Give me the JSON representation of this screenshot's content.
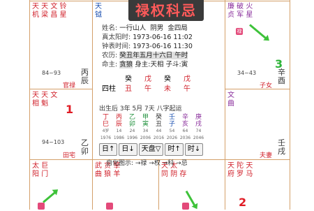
{
  "banner": "禄权科忌",
  "chart_info": {
    "name_label": "姓名:",
    "name_value": "一行山人",
    "gender": "阴男",
    "bureau": "金四局",
    "solar_label": "真太阳时:",
    "solar_value": "1973-06-16",
    "solar_time": "11:02",
    "clock_label": "钟表时间:",
    "clock_value": "1973-06-16",
    "clock_time": "11:30",
    "lunar_label": "农历:",
    "lunar_value": "癸丑年五月十六日 午时",
    "master_label": "命主:",
    "master_value": "贪狼",
    "body_label": "身主:天相",
    "ziniu": "子斗:寅"
  },
  "pillars": {
    "label": "四柱",
    "stems": [
      "癸",
      "戊",
      "癸",
      "戊"
    ],
    "branches": [
      "丑",
      "午",
      "未",
      "午"
    ]
  },
  "luck": {
    "title": "出生后 3年 5月 7天 八字起运",
    "stems": [
      "丁",
      "丙",
      "乙",
      "甲",
      "癸",
      "壬",
      "辛",
      "庚"
    ],
    "branches": [
      "巳",
      "辰",
      "卯",
      "寅",
      "丑",
      "子",
      "亥",
      "戌"
    ],
    "ages": [
      "4岁",
      "14",
      "24",
      "34",
      "44",
      "54",
      "64",
      "74"
    ],
    "years": [
      "1976",
      "1986",
      "1996",
      "2006",
      "2016",
      "2026",
      "2036",
      "2046"
    ]
  },
  "buttons": [
    "日↑",
    "日↓",
    "天盘▽",
    "时↑",
    "时↓"
  ],
  "legend": "自化图示: →禄 →权 →科 →忌",
  "cells": {
    "si": {
      "stars": "天 天 文 铃\n机 梁 昌 星"
    },
    "wu": {
      "stars": "天\n钺"
    },
    "shen": {
      "stars": "廉 破 火\n贞 军 星",
      "tag": "禄"
    },
    "chen": {
      "stars": "天 天 文\n相 魁",
      "age": "84~93",
      "palace": "官禄",
      "branch": "丙\n辰"
    },
    "you": {
      "stars": "文\n曲",
      "age": "34~43",
      "palace": "子女",
      "branch": "辛\n酉"
    },
    "mao": {
      "stars": "天\n机",
      "age": "94~103",
      "palace": "田宅",
      "branch": "乙\n卯"
    },
    "xu": {
      "stars": "",
      "palace": "夫妻",
      "branch": "壬\n戌"
    },
    "yin": {
      "stars": "太 巨\n阳 门"
    },
    "chou": {
      "stars": "武 贪 擎\n曲 狼 羊"
    },
    "zi": {
      "stars": "天 太\n同 阴 存"
    },
    "hai": {
      "stars": "天 陀 天\n府 罗 马"
    }
  },
  "numbers": {
    "n1": "1",
    "n2": "2",
    "n3": "3"
  },
  "colors": {
    "accent": "#e01b24",
    "arrow": "#3ec23a",
    "grid": "#d4a06a"
  }
}
